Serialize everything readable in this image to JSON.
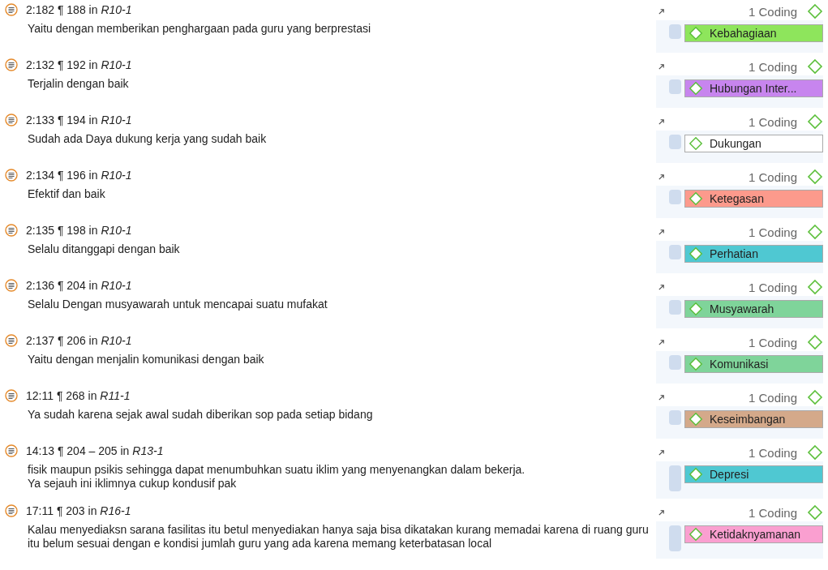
{
  "quotes": [
    {
      "header": "2:182 ¶ 188 in *R10-1*",
      "lines": [
        "Yaitu dengan memberikan penghargaan pada guru yang berprestasi"
      ],
      "coding_count": "1 Coding",
      "code": {
        "name": "Kebahagiaan",
        "color": "#8ee55c"
      }
    },
    {
      "header": "2:132 ¶ 192 in *R10-1*",
      "lines": [
        "Terjalin dengan baik"
      ],
      "coding_count": "1 Coding",
      "code": {
        "name": "Hubungan Inter...",
        "color": "#c785ee"
      }
    },
    {
      "header": "2:133 ¶ 194 in *R10-1*",
      "lines": [
        "Sudah ada Daya dukung kerja yang sudah baik"
      ],
      "coding_count": "1 Coding",
      "code": {
        "name": "Dukungan",
        "color": "#ffffff"
      }
    },
    {
      "header": "2:134 ¶ 196 in *R10-1*",
      "lines": [
        "Efektif dan baik"
      ],
      "coding_count": "1 Coding",
      "code": {
        "name": "Ketegasan",
        "color": "#fc9a8c"
      }
    },
    {
      "header": "2:135 ¶ 198 in *R10-1*",
      "lines": [
        "Selalu ditanggapi dengan baik"
      ],
      "coding_count": "1 Coding",
      "code": {
        "name": "Perhatian",
        "color": "#4fc8d2"
      }
    },
    {
      "header": "2:136 ¶ 204 in *R10-1*",
      "lines": [
        "Selalu Dengan musyawarah untuk mencapai suatu mufakat"
      ],
      "coding_count": "1 Coding",
      "code": {
        "name": "Musyawarah",
        "color": "#7fd49a"
      }
    },
    {
      "header": "2:137 ¶ 206 in *R10-1*",
      "lines": [
        "Yaitu dengan menjalin komunikasi dengan baik"
      ],
      "coding_count": "1 Coding",
      "code": {
        "name": "Komunikasi",
        "color": "#7fd49a"
      }
    },
    {
      "header": "12:11 ¶ 268 in *R11-1*",
      "lines": [
        "Ya sudah karena sejak awal sudah diberikan sop pada setiap bidang"
      ],
      "coding_count": "1 Coding",
      "code": {
        "name": "Keseimbangan",
        "color": "#d4a98a"
      }
    },
    {
      "header": "14:13 ¶ 204 – 205 in *R13-1*",
      "lines": [
        "fisik maupun psikis sehingga dapat menumbuhkan suatu iklim yang menyenangkan dalam bekerja.",
        "Ya sejauh ini iklimnya cukup kondusif pak"
      ],
      "coding_count": "1 Coding",
      "code": {
        "name": "Depresi",
        "color": "#4fc8d2"
      }
    },
    {
      "header": "17:11 ¶ 203 in *R16-1*",
      "lines": [
        "Kalau menyediaksn sarana fasilitas itu betul menyediakan hanya saja bisa dikatakan kurang memadai  karena di ruang guru",
        "itu belum sesuai dengan e kondisi jumlah guru yang ada karena memang keterbatasan local"
      ],
      "coding_count": "1 Coding",
      "code": {
        "name": "Ketidaknyamanan",
        "color": "#fa9fd0"
      }
    }
  ]
}
